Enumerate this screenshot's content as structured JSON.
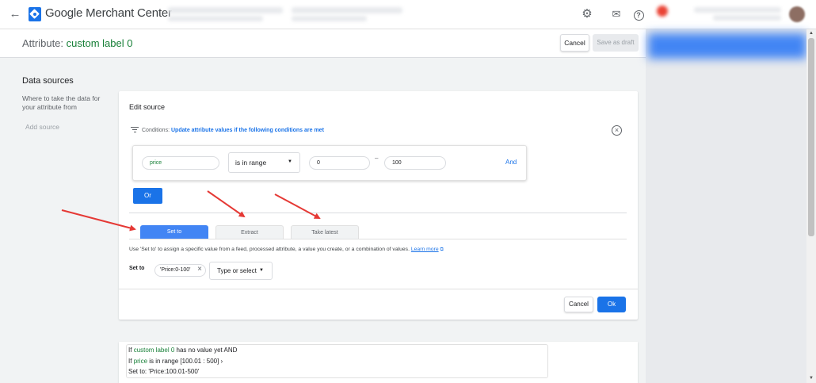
{
  "topbar": {
    "back_icon": "arrow-back-icon",
    "brand": "Google Merchant Center",
    "icons": [
      "gear-icon",
      "mail-icon",
      "help-icon"
    ]
  },
  "header": {
    "title_prefix": "Attribute:",
    "title_value": "custom label 0",
    "cancel_label": "Cancel",
    "save_draft_label": "Save as draft"
  },
  "data_sources": {
    "title": "Data sources",
    "description": "Where to take the data for your attribute from",
    "add_source_label": "Add source"
  },
  "editor": {
    "title": "Edit source",
    "conditions_label": "Conditions:",
    "conditions_text": "Update attribute values if the following conditions are met",
    "condition": {
      "attribute": "price",
      "operator": "is in range",
      "min": "0",
      "dash": "–",
      "max": "100",
      "and_label": "And"
    },
    "or_label": "Or",
    "tabs": [
      "Set to",
      "Extract",
      "Take latest"
    ],
    "active_tab": 0,
    "help_text": "Use 'Set to' to assign a specific value from a feed, processed attribute, a value you create, or a combination of values.",
    "learn_more": "Learn more",
    "set_to_label": "Set to",
    "set_to_chip": "'Price:0-100'",
    "type_select_placeholder": "Type or select",
    "cancel_label": "Cancel",
    "ok_label": "Ok"
  },
  "existing_rule": {
    "line1_prefix": "If",
    "line1_attr": "custom label 0",
    "line1_suffix": "has no value yet AND",
    "line2_prefix": "If",
    "line2_attr": "price",
    "line2_suffix": "is in range [100.01 : 500] ›",
    "line3": "Set to: 'Price:100.01-500'"
  },
  "colors": {
    "accent": "#1a73e8",
    "attribute_green": "#188038",
    "annotation_arrow": "#e53935"
  }
}
